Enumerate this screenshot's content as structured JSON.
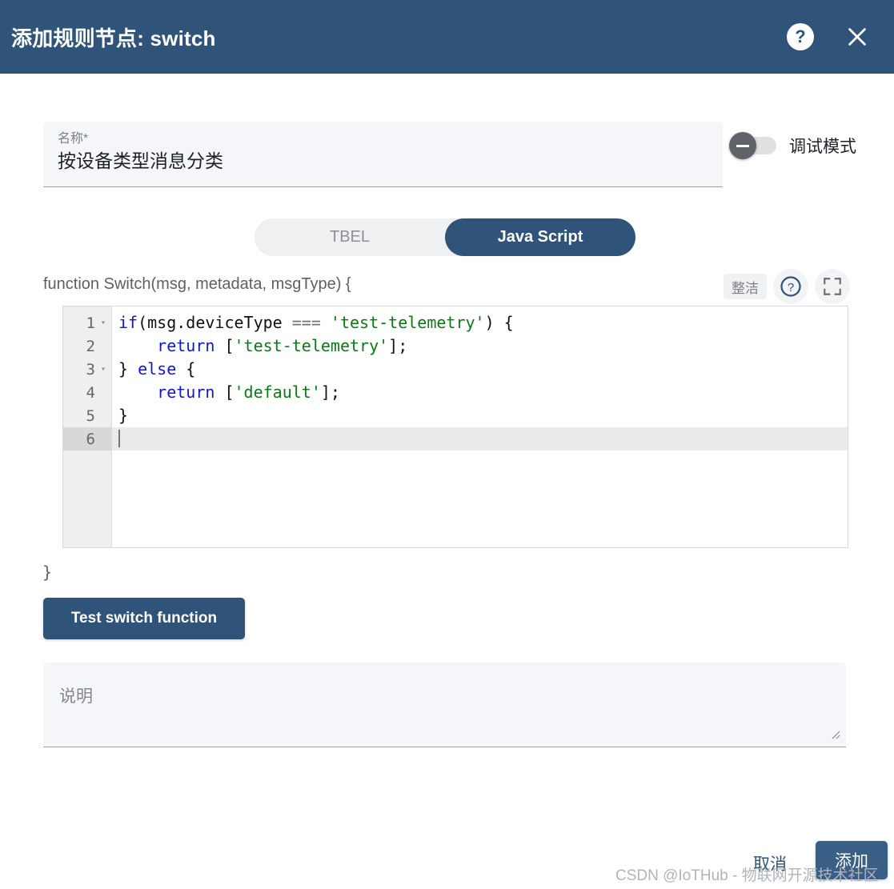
{
  "header": {
    "title": "添加规则节点: switch",
    "help_icon": "help-circle-icon",
    "help_glyph": "?",
    "close_icon": "close-icon",
    "background_color": "#2f5379"
  },
  "name_field": {
    "label": "名称*",
    "value": "按设备类型消息分类"
  },
  "debug_toggle": {
    "label": "调试模式",
    "state": "off",
    "thumb_glyph": "minus"
  },
  "language_tabs": {
    "options": [
      "TBEL",
      "Java Script"
    ],
    "selected": "Java Script",
    "inactive_label": "TBEL",
    "active_label": "Java Script"
  },
  "editor": {
    "signature": "function Switch(msg, metadata, msgType) {",
    "closing_brace": "}",
    "toolbar": {
      "tidy_label": "整洁",
      "help_icon": "help-circle-icon",
      "help_glyph": "?",
      "fullscreen_icon": "fullscreen-expand-icon"
    },
    "lines": [
      {
        "num": "1",
        "foldable": true,
        "active": false,
        "tokens": [
          {
            "t": "if",
            "c": "kw"
          },
          {
            "t": "(msg.deviceType ",
            "c": "pl"
          },
          {
            "t": "===",
            "c": "op"
          },
          {
            "t": " ",
            "c": "pl"
          },
          {
            "t": "'test-telemetry'",
            "c": "str"
          },
          {
            "t": ") {",
            "c": "pl"
          }
        ]
      },
      {
        "num": "2",
        "foldable": false,
        "active": false,
        "tokens": [
          {
            "t": "    ",
            "c": "pl"
          },
          {
            "t": "return",
            "c": "kw"
          },
          {
            "t": " [",
            "c": "pl"
          },
          {
            "t": "'test-telemetry'",
            "c": "str"
          },
          {
            "t": "];",
            "c": "pl"
          }
        ]
      },
      {
        "num": "3",
        "foldable": true,
        "active": false,
        "tokens": [
          {
            "t": "} ",
            "c": "pl"
          },
          {
            "t": "else",
            "c": "kw"
          },
          {
            "t": " {",
            "c": "pl"
          }
        ]
      },
      {
        "num": "4",
        "foldable": false,
        "active": false,
        "tokens": [
          {
            "t": "    ",
            "c": "pl"
          },
          {
            "t": "return",
            "c": "kw"
          },
          {
            "t": " [",
            "c": "pl"
          },
          {
            "t": "'default'",
            "c": "str"
          },
          {
            "t": "];",
            "c": "pl"
          }
        ]
      },
      {
        "num": "5",
        "foldable": false,
        "active": false,
        "tokens": [
          {
            "t": "}",
            "c": "pl"
          }
        ]
      },
      {
        "num": "6",
        "foldable": false,
        "active": true,
        "tokens": []
      }
    ]
  },
  "test_button": {
    "label": "Test switch function"
  },
  "description": {
    "placeholder": "说明",
    "value": ""
  },
  "footer": {
    "cancel_label": "取消",
    "add_label": "添加"
  },
  "watermark": {
    "text": "CSDN @IoTHub - 物联网开源技术社区"
  }
}
